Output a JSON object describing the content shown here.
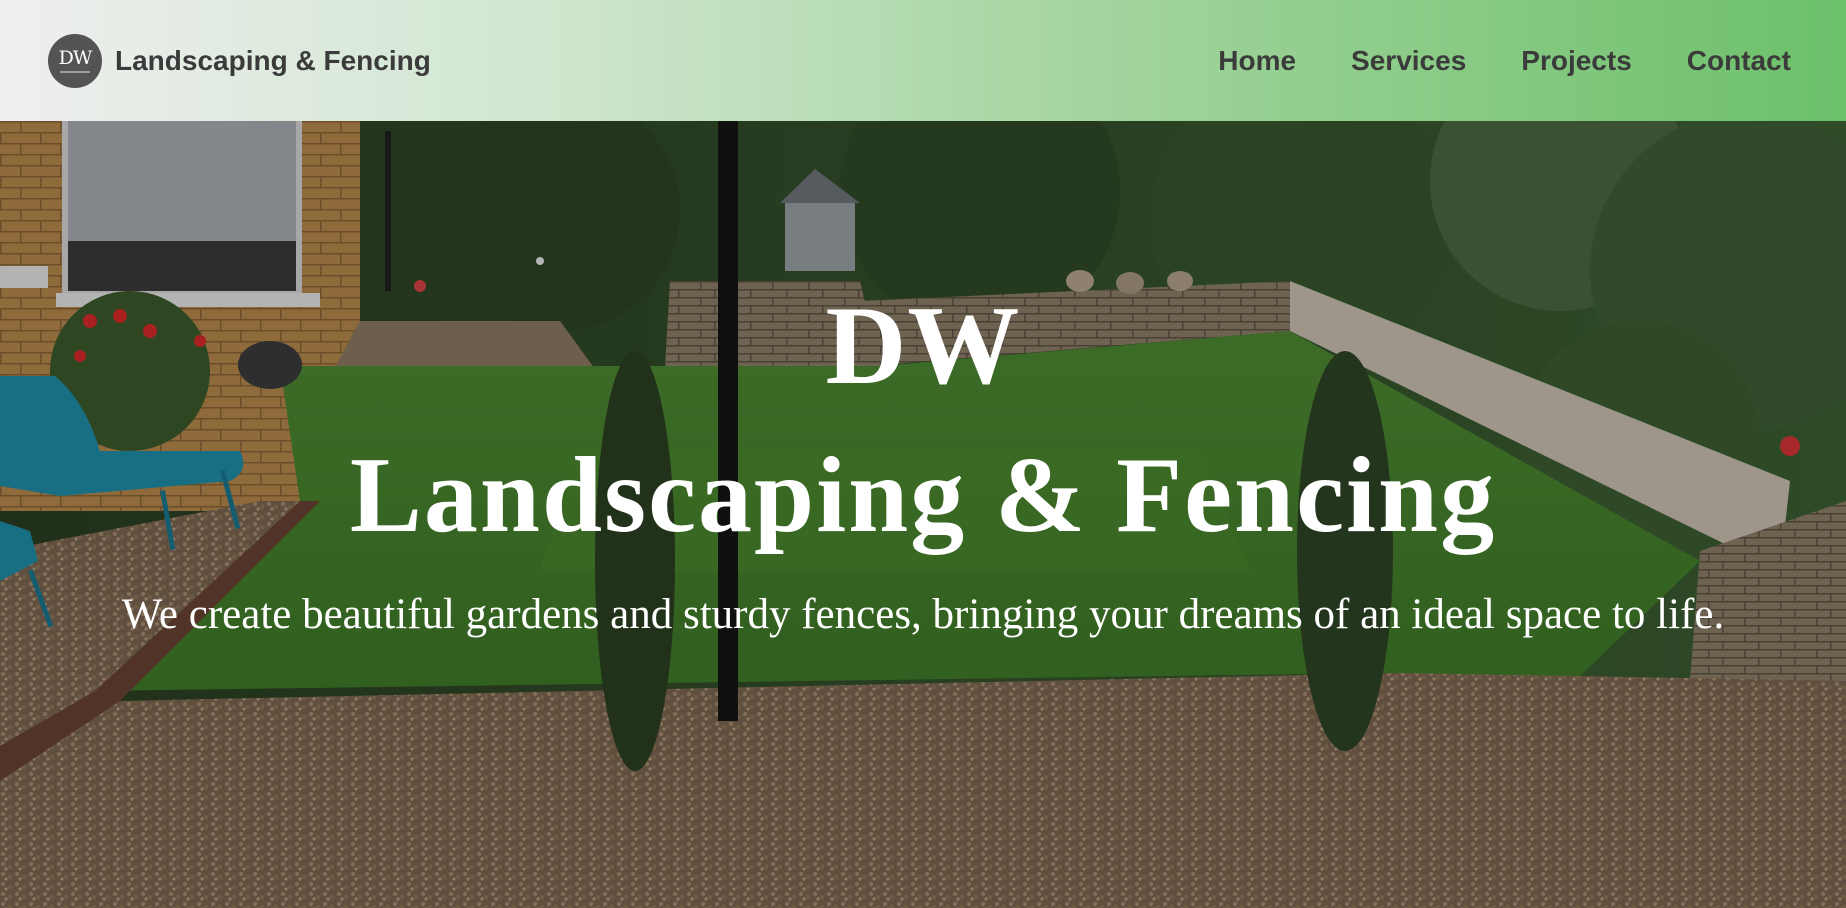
{
  "brand": {
    "logo_text": "DW",
    "name": "Landscaping & Fencing"
  },
  "nav": {
    "items": [
      {
        "label": "Home"
      },
      {
        "label": "Services"
      },
      {
        "label": "Projects"
      },
      {
        "label": "Contact"
      }
    ]
  },
  "hero": {
    "title_top": "DW",
    "title_main": "Landscaping & Fencing",
    "tagline": "We create beautiful gardens and sturdy fences, bringing your dreams of an ideal space to life."
  },
  "colors": {
    "nav_gradient_start": "#efefef",
    "nav_gradient_end": "#6cc06a",
    "nav_text": "#3b3b3b",
    "logo_bg": "#545454",
    "hero_text": "#ffffff"
  }
}
